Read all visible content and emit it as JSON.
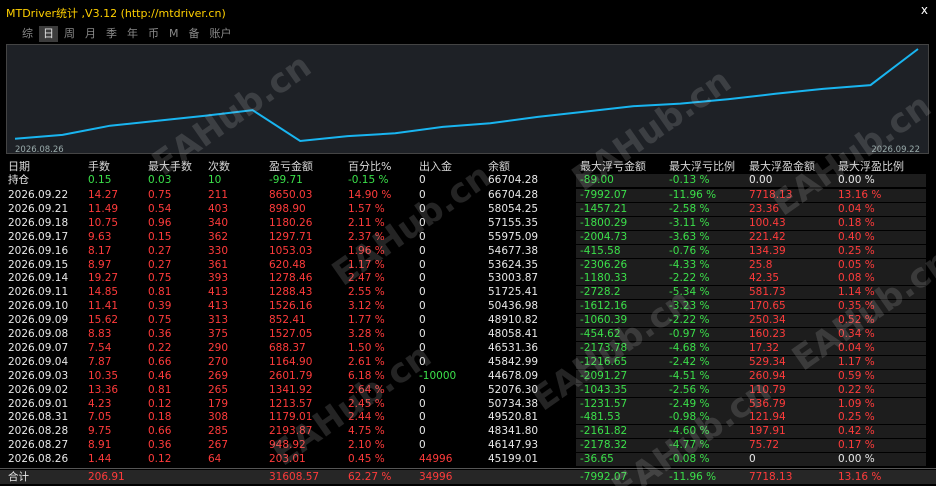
{
  "window": {
    "title": "MTDriver统计 ,V3.12 (http://mtdriver.cn)",
    "close_symbol": "x"
  },
  "tabs": [
    "综",
    "日",
    "周",
    "月",
    "季",
    "年",
    "币",
    "M",
    "备",
    "账户"
  ],
  "active_tab_index": 1,
  "chart": {
    "start_label": "2026.08.26",
    "end_label": "2026.09.22",
    "line_color": "#19b5f0",
    "background": "#1e2126"
  },
  "chart_data": {
    "type": "line",
    "x": [
      "2026.08.26",
      "2026.08.27",
      "2026.08.28",
      "2026.08.31",
      "2026.09.01",
      "2026.09.02",
      "2026.09.03",
      "2026.09.04",
      "2026.09.07",
      "2026.09.08",
      "2026.09.09",
      "2026.09.10",
      "2026.09.11",
      "2026.09.14",
      "2026.09.15",
      "2026.09.16",
      "2026.09.17",
      "2026.09.18",
      "2026.09.21",
      "2026.09.22"
    ],
    "series": [
      {
        "values": [
          45199.01,
          46147.93,
          48341.8,
          49520.81,
          50734.38,
          52076.3,
          44678.09,
          45842.99,
          46531.36,
          48058.41,
          48910.82,
          50436.98,
          51725.41,
          53003.87,
          53624.35,
          54677.38,
          55975.09,
          57155.35,
          58054.25,
          66704.28
        ]
      }
    ]
  },
  "headers": [
    "日期",
    "手数",
    "最大手数",
    "次数",
    "盈亏金额",
    "百分比%",
    "出入金",
    "余额",
    "最大浮亏金额",
    "最大浮亏比例",
    "最大浮盈金额",
    "最大浮盈比例"
  ],
  "position_row": [
    "持仓",
    "0.15",
    "0.03",
    "10",
    "-99.71",
    "-0.15 %",
    "0",
    "66704.28",
    "-89.00",
    "-0.13 %",
    "0.00",
    "0.00 %"
  ],
  "rows": [
    [
      "2026.09.22",
      "14.27",
      "0.75",
      "211",
      "8650.03",
      "14.90 %",
      "0",
      "66704.28",
      "-7992.07",
      "-11.96 %",
      "7718.13",
      "13.16 %"
    ],
    [
      "2026.09.21",
      "11.49",
      "0.54",
      "403",
      "898.90",
      "1.57 %",
      "0",
      "58054.25",
      "-1457.21",
      "-2.58 %",
      "23.36",
      "0.04 %"
    ],
    [
      "2026.09.18",
      "10.75",
      "0.96",
      "340",
      "1180.26",
      "2.11 %",
      "0",
      "57155.35",
      "-1800.29",
      "-3.11 %",
      "100.43",
      "0.18 %"
    ],
    [
      "2026.09.17",
      "9.63",
      "0.15",
      "362",
      "1297.71",
      "2.37 %",
      "0",
      "55975.09",
      "-2004.73",
      "-3.63 %",
      "221.42",
      "0.40 %"
    ],
    [
      "2026.09.16",
      "8.17",
      "0.27",
      "330",
      "1053.03",
      "1.96 %",
      "0",
      "54677.38",
      "-415.58",
      "-0.76 %",
      "134.39",
      "0.25 %"
    ],
    [
      "2026.09.15",
      "8.97",
      "0.27",
      "361",
      "620.48",
      "1.17 %",
      "0",
      "53624.35",
      "-2306.26",
      "-4.33 %",
      "25.8",
      "0.05 %"
    ],
    [
      "2026.09.14",
      "19.27",
      "0.75",
      "393",
      "1278.46",
      "2.47 %",
      "0",
      "53003.87",
      "-1180.33",
      "-2.22 %",
      "42.35",
      "0.08 %"
    ],
    [
      "2026.09.11",
      "14.85",
      "0.81",
      "413",
      "1288.43",
      "2.55 %",
      "0",
      "51725.41",
      "-2728.2",
      "-5.34 %",
      "581.73",
      "1.14 %"
    ],
    [
      "2026.09.10",
      "11.41",
      "0.39",
      "413",
      "1526.16",
      "3.12 %",
      "0",
      "50436.98",
      "-1612.16",
      "-3.23 %",
      "170.65",
      "0.35 %"
    ],
    [
      "2026.09.09",
      "15.62",
      "0.75",
      "313",
      "852.41",
      "1.77 %",
      "0",
      "48910.82",
      "-1060.39",
      "-2.22 %",
      "250.34",
      "0.52 %"
    ],
    [
      "2026.09.08",
      "8.83",
      "0.36",
      "375",
      "1527.05",
      "3.28 %",
      "0",
      "48058.41",
      "-454.62",
      "-0.97 %",
      "160.23",
      "0.34 %"
    ],
    [
      "2026.09.07",
      "7.54",
      "0.22",
      "290",
      "688.37",
      "1.50 %",
      "0",
      "46531.36",
      "-2173.78",
      "-4.68 %",
      "17.32",
      "0.04 %"
    ],
    [
      "2026.09.04",
      "7.87",
      "0.66",
      "270",
      "1164.90",
      "2.61 %",
      "0",
      "45842.99",
      "-1216.65",
      "-2.42 %",
      "529.34",
      "1.17 %"
    ],
    [
      "2026.09.03",
      "10.35",
      "0.46",
      "269",
      "2601.79",
      "6.18 %",
      "-10000",
      "44678.09",
      "-2091.27",
      "-4.51 %",
      "260.94",
      "0.59 %"
    ],
    [
      "2026.09.02",
      "13.36",
      "0.81",
      "265",
      "1341.92",
      "2.64 %",
      "0",
      "52076.30",
      "-1043.35",
      "-2.56 %",
      "110.79",
      "0.22 %"
    ],
    [
      "2026.09.01",
      "4.23",
      "0.12",
      "179",
      "1213.57",
      "2.45 %",
      "0",
      "50734.38",
      "-1231.57",
      "-2.49 %",
      "536.79",
      "1.09 %"
    ],
    [
      "2026.08.31",
      "7.05",
      "0.18",
      "308",
      "1179.01",
      "2.44 %",
      "0",
      "49520.81",
      "-481.53",
      "-0.98 %",
      "121.94",
      "0.25 %"
    ],
    [
      "2026.08.28",
      "9.75",
      "0.66",
      "285",
      "2193.87",
      "4.75 %",
      "0",
      "48341.80",
      "-2161.82",
      "-4.60 %",
      "197.91",
      "0.42 %"
    ],
    [
      "2026.08.27",
      "8.91",
      "0.36",
      "267",
      "948.92",
      "2.10 %",
      "0",
      "46147.93",
      "-2178.32",
      "-4.77 %",
      "75.72",
      "0.17 %"
    ],
    [
      "2026.08.26",
      "1.44",
      "0.12",
      "64",
      "203.01",
      "0.45 %",
      "44996",
      "45199.01",
      "-36.65",
      "-0.08 %",
      "0",
      "0.00 %"
    ]
  ],
  "total_row": [
    "合计",
    "206.91",
    "",
    "",
    "31608.57",
    "62.27 %",
    "34996",
    "",
    "-7992.07",
    "-11.96 %",
    "7718.13",
    "13.16 %"
  ],
  "watermark_text": "EAHub.cn"
}
